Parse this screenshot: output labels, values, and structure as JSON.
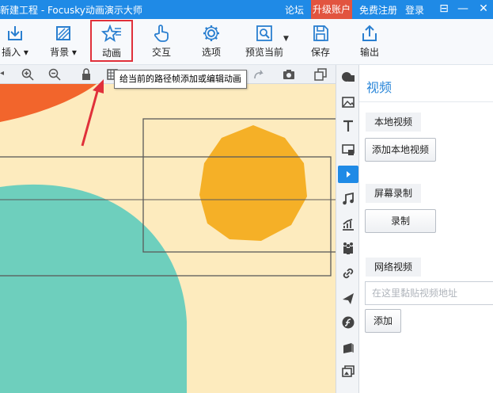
{
  "titlebar": {
    "title": "新建工程 - Focusky动画演示大师",
    "links": {
      "forum": "论坛",
      "upgrade": "升级账户",
      "register": "免费注册",
      "login": "登录"
    },
    "window_buttons": {
      "menu": "⊟",
      "minimize": "—",
      "close": "✕"
    }
  },
  "toolbar": {
    "items": [
      {
        "label": "插入",
        "icon": "insert-icon"
      },
      {
        "label": "背景",
        "icon": "background-icon"
      },
      {
        "label": "动画",
        "icon": "animation-star-icon"
      },
      {
        "label": "交互",
        "icon": "hand-pointer-icon"
      },
      {
        "label": "选项",
        "icon": "gear-icon"
      },
      {
        "label": "预览当前",
        "icon": "preview-icon"
      },
      {
        "label": "保存",
        "icon": "save-icon"
      },
      {
        "label": "输出",
        "icon": "export-icon"
      }
    ]
  },
  "tooltip": {
    "text": "给当前的路径帧添加或编辑动画"
  },
  "panel": {
    "title": "视频",
    "local": {
      "section": "本地视频",
      "button": "添加本地视频"
    },
    "record": {
      "section": "屏幕录制",
      "button": "录制"
    },
    "web": {
      "section": "网络视频",
      "placeholder": "在这里黏贴视频地址",
      "button": "添加"
    }
  },
  "colors": {
    "titlebar": "#1f8ae6",
    "upgrade": "#e2543f",
    "canvas_bg": "#fdebbe",
    "circle_teal": "#6ecfbd",
    "circle_orange": "#f5b027",
    "shape_red": "#f2652c",
    "highlight": "#e0303a"
  }
}
